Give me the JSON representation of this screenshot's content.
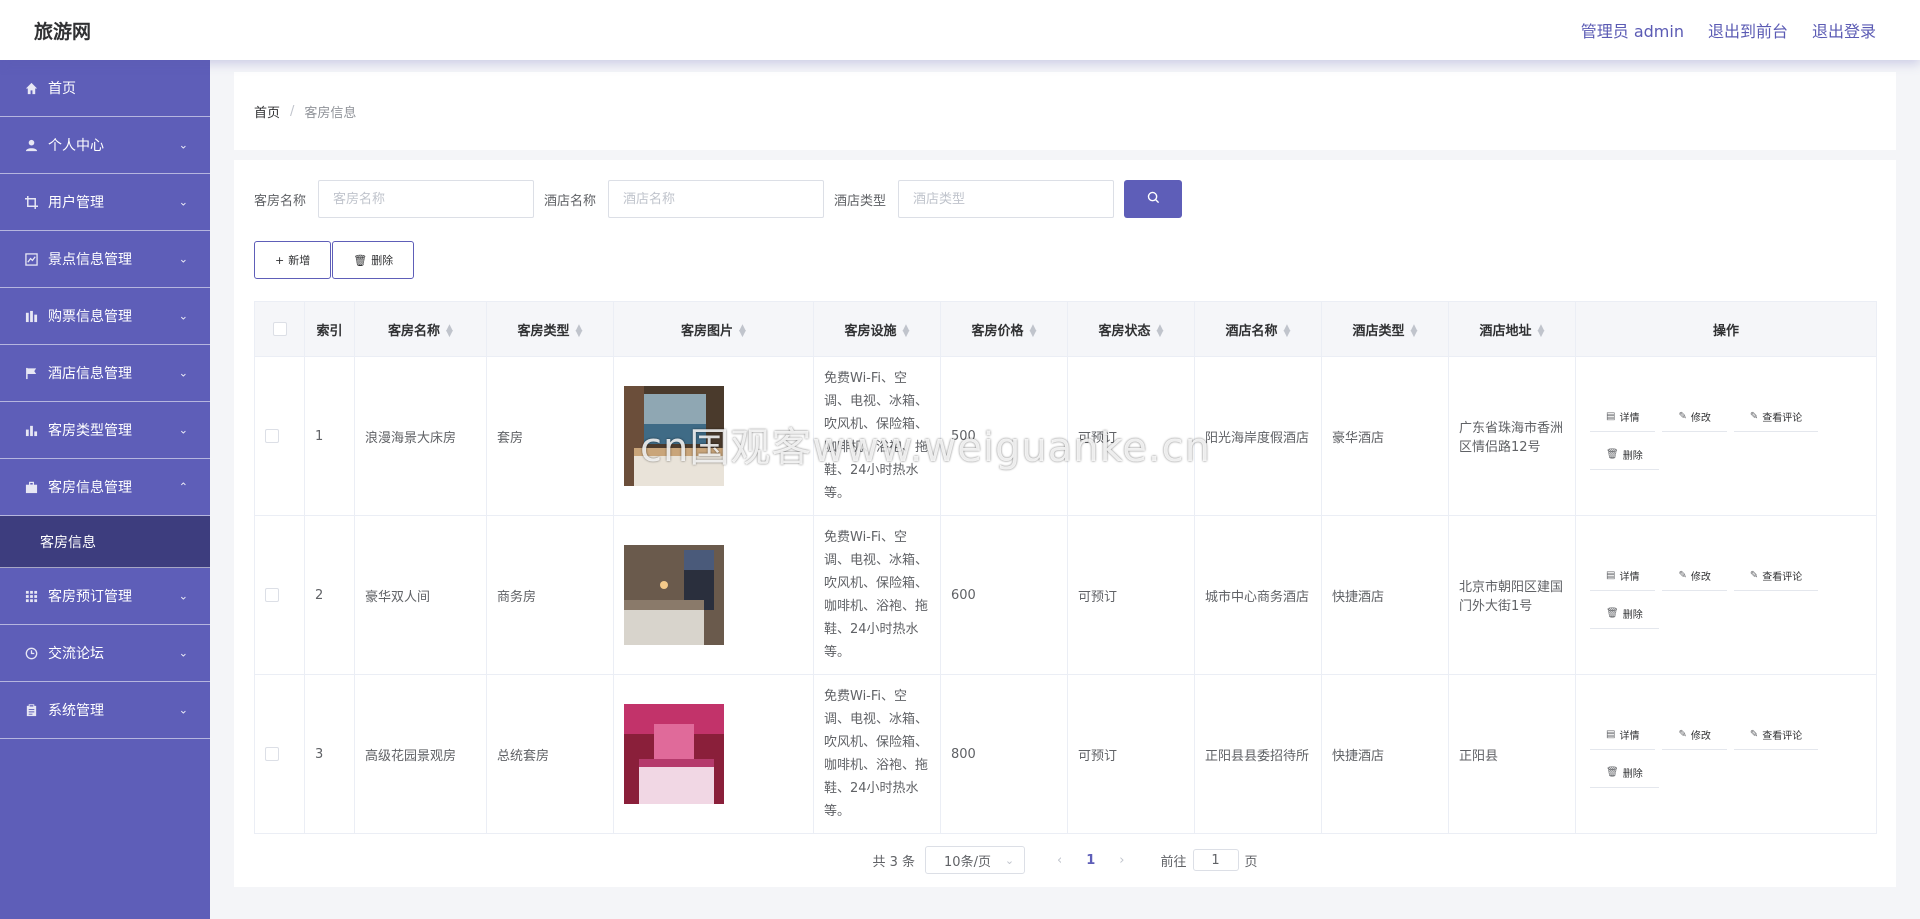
{
  "header": {
    "title": "旅游网",
    "admin_label": "管理员 admin",
    "to_front_label": "退出到前台",
    "logout_label": "退出登录"
  },
  "sidebar": {
    "items": [
      {
        "label": "首页",
        "icon": "home-icon",
        "arrow": ""
      },
      {
        "label": "个人中心",
        "icon": "user-icon",
        "arrow": "chevron-down"
      },
      {
        "label": "用户管理",
        "icon": "crop-icon",
        "arrow": "chevron-down"
      },
      {
        "label": "景点信息管理",
        "icon": "chart-icon",
        "arrow": "chevron-down"
      },
      {
        "label": "购票信息管理",
        "icon": "ticket-icon",
        "arrow": "chevron-down"
      },
      {
        "label": "酒店信息管理",
        "icon": "flag-icon",
        "arrow": "chevron-down"
      },
      {
        "label": "客房类型管理",
        "icon": "bar-chart-icon",
        "arrow": "chevron-down"
      },
      {
        "label": "客房信息管理",
        "icon": "briefcase-icon",
        "arrow": "chevron-up"
      },
      {
        "label": "客房预订管理",
        "icon": "grid-icon",
        "arrow": "chevron-down"
      },
      {
        "label": "交流论坛",
        "icon": "clock-icon",
        "arrow": "chevron-down"
      },
      {
        "label": "系统管理",
        "icon": "clipboard-icon",
        "arrow": "chevron-down"
      }
    ],
    "submenu_label": "客房信息"
  },
  "breadcrumb": {
    "home": "首页",
    "separator": "/",
    "current": "客房信息"
  },
  "search": {
    "room_name_label": "客房名称",
    "room_name_placeholder": "客房名称",
    "hotel_name_label": "酒店名称",
    "hotel_name_placeholder": "酒店名称",
    "hotel_type_label": "酒店类型",
    "hotel_type_placeholder": "酒店类型"
  },
  "actions": {
    "add_label": "新增",
    "delete_label": "删除"
  },
  "table": {
    "columns": [
      "索引",
      "客房名称",
      "客房类型",
      "客房图片",
      "客房设施",
      "客房价格",
      "客房状态",
      "酒店名称",
      "酒店类型",
      "酒店地址",
      "操作"
    ],
    "rows": [
      {
        "index": "1",
        "room_name": "浪漫海景大床房",
        "room_type": "套房",
        "facilities": "免费Wi-Fi、空调、电视、冰箱、吹风机、保险箱、咖啡机、浴袍、拖鞋、24小时热水等。",
        "price": "500",
        "status": "可预订",
        "hotel_name": "阳光海岸度假酒店",
        "hotel_type": "豪华酒店",
        "address": "广东省珠海市香洲区情侣路12号"
      },
      {
        "index": "2",
        "room_name": "豪华双人间",
        "room_type": "商务房",
        "facilities": "免费Wi-Fi、空调、电视、冰箱、吹风机、保险箱、咖啡机、浴袍、拖鞋、24小时热水等。",
        "price": "600",
        "status": "可预订",
        "hotel_name": "城市中心商务酒店",
        "hotel_type": "快捷酒店",
        "address": "北京市朝阳区建国门外大街1号"
      },
      {
        "index": "3",
        "room_name": "高级花园景观房",
        "room_type": "总统套房",
        "facilities": "免费Wi-Fi、空调、电视、冰箱、吹风机、保险箱、咖啡机、浴袍、拖鞋、24小时热水等。",
        "price": "800",
        "status": "可预订",
        "hotel_name": "正阳县县委招待所",
        "hotel_type": "快捷酒店",
        "address": "正阳县"
      }
    ],
    "op_labels": {
      "detail": "详情",
      "edit": "修改",
      "comments": "查看评论",
      "delete": "删除"
    }
  },
  "pagination": {
    "total": "共 3 条",
    "page_size": "10条/页",
    "current_page": "1",
    "goto_label": "前往",
    "goto_value": "1",
    "page_suffix": "页"
  },
  "watermark": "cn国观客www.weiguanke.cn",
  "colors": {
    "accent": "#5e5eb8",
    "submenu_active": "#3d3d7e"
  }
}
